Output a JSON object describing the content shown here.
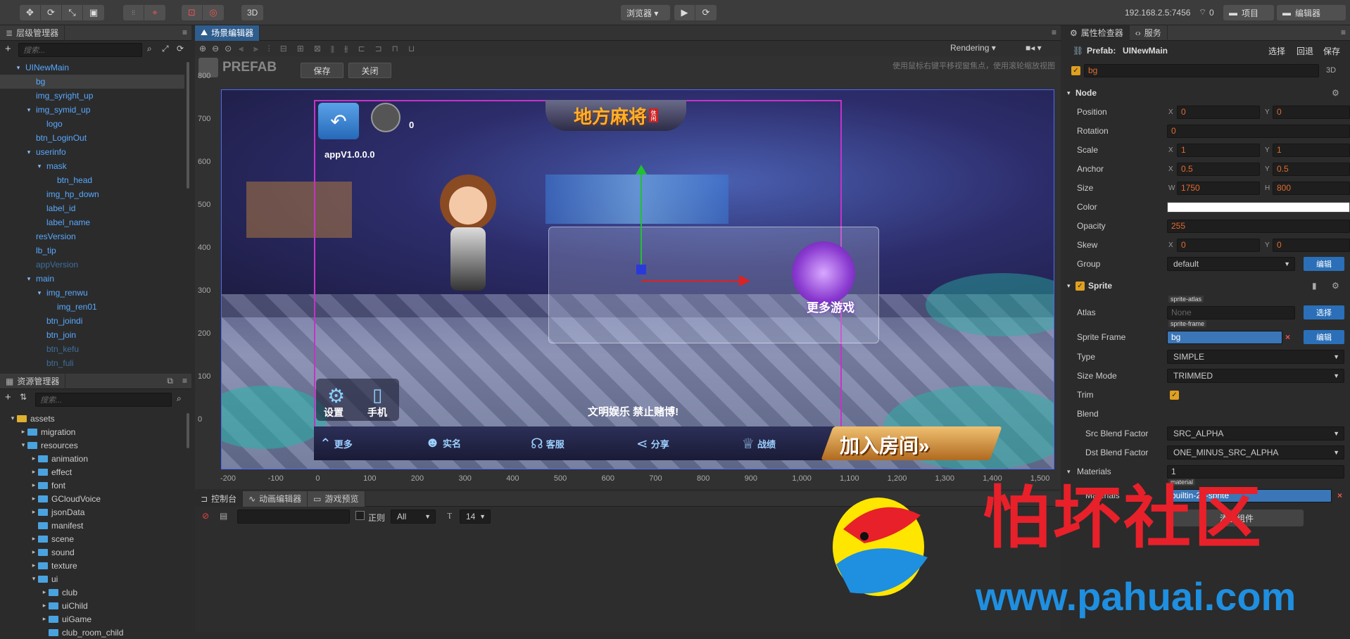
{
  "toolbar": {
    "left_tools": [
      "move-tool-icon",
      "rotate-tool-icon",
      "scale-tool-icon",
      "rect-tool-icon"
    ],
    "preview_label": "浏览器 ▾",
    "mode_3d": "3D",
    "ip_address": "192.168.2.5:7456",
    "wifi_count": "0",
    "project_label": "项目",
    "editor_label": "编辑器"
  },
  "hierarchy": {
    "title": "层级管理器",
    "search_placeholder": "搜索...",
    "items": [
      {
        "label": "UINewMain",
        "indent": 0,
        "arrow": "▾",
        "state": "normal"
      },
      {
        "label": "bg",
        "indent": 1,
        "arrow": "",
        "state": "selected"
      },
      {
        "label": "img_syright_up",
        "indent": 1,
        "arrow": "",
        "state": "normal"
      },
      {
        "label": "img_symid_up",
        "indent": 1,
        "arrow": "▾",
        "state": "normal"
      },
      {
        "label": "logo",
        "indent": 2,
        "arrow": "",
        "state": "normal"
      },
      {
        "label": "btn_LoginOut",
        "indent": 1,
        "arrow": "",
        "state": "normal"
      },
      {
        "label": "userinfo",
        "indent": 1,
        "arrow": "▾",
        "state": "normal"
      },
      {
        "label": "mask",
        "indent": 2,
        "arrow": "▾",
        "state": "normal"
      },
      {
        "label": "btn_head",
        "indent": 3,
        "arrow": "",
        "state": "normal"
      },
      {
        "label": "img_hp_down",
        "indent": 2,
        "arrow": "",
        "state": "normal"
      },
      {
        "label": "label_id",
        "indent": 2,
        "arrow": "",
        "state": "normal"
      },
      {
        "label": "label_name",
        "indent": 2,
        "arrow": "",
        "state": "normal"
      },
      {
        "label": "resVersion",
        "indent": 1,
        "arrow": "",
        "state": "normal"
      },
      {
        "label": "lb_tip",
        "indent": 1,
        "arrow": "",
        "state": "normal"
      },
      {
        "label": "appVersion",
        "indent": 1,
        "arrow": "",
        "state": "dim"
      },
      {
        "label": "main",
        "indent": 1,
        "arrow": "▾",
        "state": "normal"
      },
      {
        "label": "img_renwu",
        "indent": 2,
        "arrow": "▾",
        "state": "normal"
      },
      {
        "label": "img_ren01",
        "indent": 3,
        "arrow": "",
        "state": "normal"
      },
      {
        "label": "btn_joindi",
        "indent": 2,
        "arrow": "",
        "state": "normal"
      },
      {
        "label": "btn_join",
        "indent": 2,
        "arrow": "",
        "state": "normal"
      },
      {
        "label": "btn_kefu",
        "indent": 2,
        "arrow": "",
        "state": "dim"
      },
      {
        "label": "btn_fuli",
        "indent": 2,
        "arrow": "",
        "state": "dim"
      }
    ]
  },
  "assets": {
    "title": "资源管理器",
    "search_placeholder": "搜索...",
    "items": [
      {
        "label": "assets",
        "indent": 0,
        "arrow": "▾",
        "type": "root"
      },
      {
        "label": "migration",
        "indent": 1,
        "arrow": "▸",
        "type": "folder"
      },
      {
        "label": "resources",
        "indent": 1,
        "arrow": "▾",
        "type": "folder"
      },
      {
        "label": "animation",
        "indent": 2,
        "arrow": "▸",
        "type": "folder"
      },
      {
        "label": "effect",
        "indent": 2,
        "arrow": "▸",
        "type": "folder"
      },
      {
        "label": "font",
        "indent": 2,
        "arrow": "▸",
        "type": "folder"
      },
      {
        "label": "GCloudVoice",
        "indent": 2,
        "arrow": "▸",
        "type": "folder"
      },
      {
        "label": "jsonData",
        "indent": 2,
        "arrow": "▸",
        "type": "folder"
      },
      {
        "label": "manifest",
        "indent": 2,
        "arrow": "",
        "type": "folder"
      },
      {
        "label": "scene",
        "indent": 2,
        "arrow": "▸",
        "type": "folder"
      },
      {
        "label": "sound",
        "indent": 2,
        "arrow": "▸",
        "type": "folder"
      },
      {
        "label": "texture",
        "indent": 2,
        "arrow": "▸",
        "type": "folder"
      },
      {
        "label": "ui",
        "indent": 2,
        "arrow": "▾",
        "type": "folder"
      },
      {
        "label": "club",
        "indent": 3,
        "arrow": "▸",
        "type": "folder"
      },
      {
        "label": "uiChild",
        "indent": 3,
        "arrow": "▸",
        "type": "folder"
      },
      {
        "label": "uiGame",
        "indent": 3,
        "arrow": "▸",
        "type": "folder"
      },
      {
        "label": "club_room_child",
        "indent": 3,
        "arrow": "",
        "type": "folder"
      }
    ]
  },
  "scene": {
    "tab_title": "场景编辑器",
    "rendering_label": "Rendering",
    "prefab_label": "PREFAB",
    "save_label": "保存",
    "close_label": "关闭",
    "hint_text": "使用鼠标右键平移视窗焦点，使用滚轮缩放视图",
    "y_ticks": [
      "800",
      "700",
      "600",
      "500",
      "400",
      "300",
      "200",
      "100",
      "0"
    ],
    "x_ticks": [
      "-200",
      "-100",
      "0",
      "100",
      "200",
      "300",
      "400",
      "500",
      "600",
      "700",
      "800",
      "900",
      "1,000",
      "1,100",
      "1,200",
      "1,300",
      "1,400",
      "1,500"
    ]
  },
  "game_view": {
    "title_logo": "地方麻将",
    "logo_tag": "休闲",
    "coins": "0",
    "version": "appV1.0.0.0",
    "more_games": "更多游戏",
    "slogan": "文明娱乐 禁止赌博!",
    "settings_label": "设置",
    "phone_label": "手机",
    "nav": [
      "更多",
      "实名",
      "客服",
      "分享",
      "战绩"
    ],
    "join_room": "加入房间"
  },
  "console": {
    "tabs": [
      "控制台",
      "动画编辑器",
      "游戏预览"
    ],
    "regex_label": "正则",
    "filter_value": "All",
    "font_size": "14"
  },
  "inspector": {
    "tabs": [
      "属性检查器",
      "服务"
    ],
    "prefab_label": "Prefab:",
    "prefab_name": "UINewMain",
    "select_label": "选择",
    "revert_label": "回退",
    "save_label": "保存",
    "node_name": "bg",
    "mode_3d": "3D",
    "node_section": "Node",
    "position": {
      "label": "Position",
      "x": "0",
      "y": "0"
    },
    "rotation": {
      "label": "Rotation",
      "value": "0"
    },
    "scale": {
      "label": "Scale",
      "x": "1",
      "y": "1"
    },
    "anchor": {
      "label": "Anchor",
      "x": "0.5",
      "y": "0.5"
    },
    "size": {
      "label": "Size",
      "w": "1750",
      "h": "800"
    },
    "color_label": "Color",
    "opacity": {
      "label": "Opacity",
      "value": "255"
    },
    "skew": {
      "label": "Skew",
      "x": "0",
      "y": "0"
    },
    "group": {
      "label": "Group",
      "value": "default",
      "edit": "编辑"
    },
    "sprite_section": "Sprite",
    "atlas": {
      "label": "Atlas",
      "tag": "sprite-atlas",
      "value": "None",
      "button": "选择"
    },
    "sprite_frame": {
      "label": "Sprite Frame",
      "tag": "sprite-frame",
      "value": "bg",
      "button": "编辑"
    },
    "type": {
      "label": "Type",
      "value": "SIMPLE"
    },
    "size_mode": {
      "label": "Size Mode",
      "value": "TRIMMED"
    },
    "trim_label": "Trim",
    "blend_label": "Blend",
    "src_blend": {
      "label": "Src Blend Factor",
      "value": "SRC_ALPHA"
    },
    "dst_blend": {
      "label": "Dst Blend Factor",
      "value": "ONE_MINUS_SRC_ALPHA"
    },
    "materials": {
      "label": "Materials",
      "value": "1"
    },
    "material_tag": "material",
    "material_label": "Materials",
    "material_value": "builtin-2d-sprite",
    "add_component": "添加组件"
  },
  "watermark": {
    "brand": "怕坏社区",
    "url": "www.pahuai.com"
  },
  "colors": {
    "accent_blue": "#2e5d8e",
    "tree_blue": "#58a9ff",
    "field_orange": "#e06c2e",
    "watermark_red": "#e8202a",
    "watermark_blue": "#1f8fe0"
  }
}
